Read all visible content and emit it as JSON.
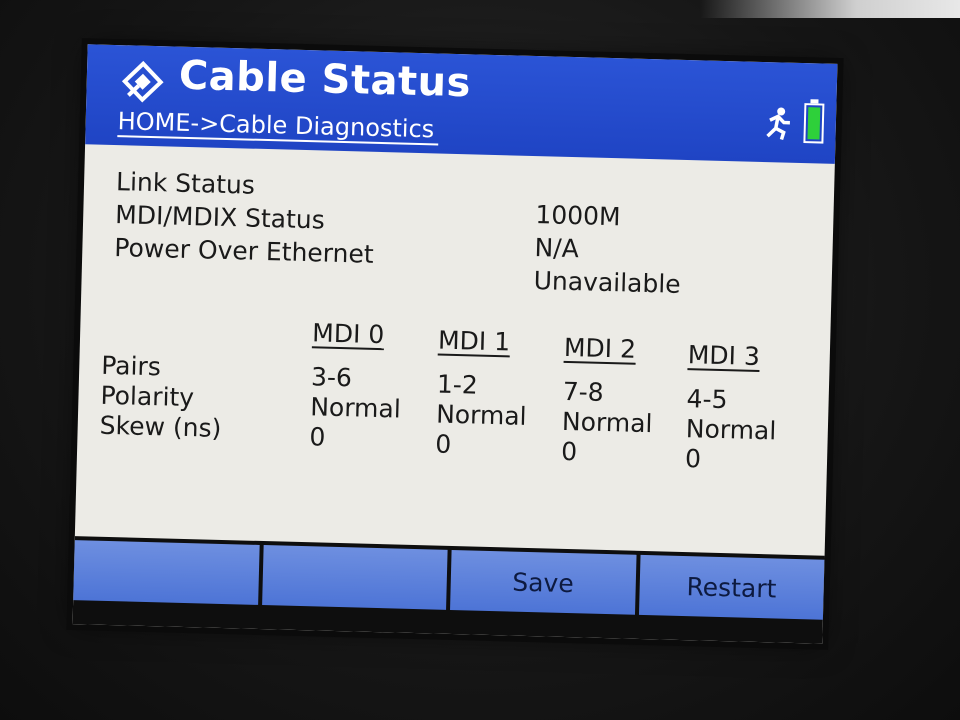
{
  "header": {
    "title": "Cable Status",
    "breadcrumb": "HOME->Cable Diagnostics",
    "icons": [
      "network-tester-logo-icon",
      "runner-icon",
      "battery-icon"
    ]
  },
  "status": {
    "rows": [
      {
        "label": "Link Status",
        "value": "1000M"
      },
      {
        "label": "MDI/MDIX Status",
        "value": "N/A"
      },
      {
        "label": "Power Over Ethernet",
        "value": "Unavailable"
      }
    ]
  },
  "pairs_table": {
    "columns": [
      "MDI 0",
      "MDI 1",
      "MDI 2",
      "MDI 3"
    ],
    "row_labels": [
      "Pairs",
      "Polarity",
      "Skew (ns)"
    ],
    "cells": [
      [
        "3-6",
        "Normal",
        "0"
      ],
      [
        "1-2",
        "Normal",
        "0"
      ],
      [
        "7-8",
        "Normal",
        "0"
      ],
      [
        "4-5",
        "Normal",
        "0"
      ]
    ]
  },
  "softkeys": [
    "",
    "",
    "Save",
    "Restart"
  ],
  "colors": {
    "title_bar": "#1f44c4",
    "screen_bg": "#ecebe6",
    "softkey": "#5a7fdc",
    "battery": "#2ed03a"
  }
}
